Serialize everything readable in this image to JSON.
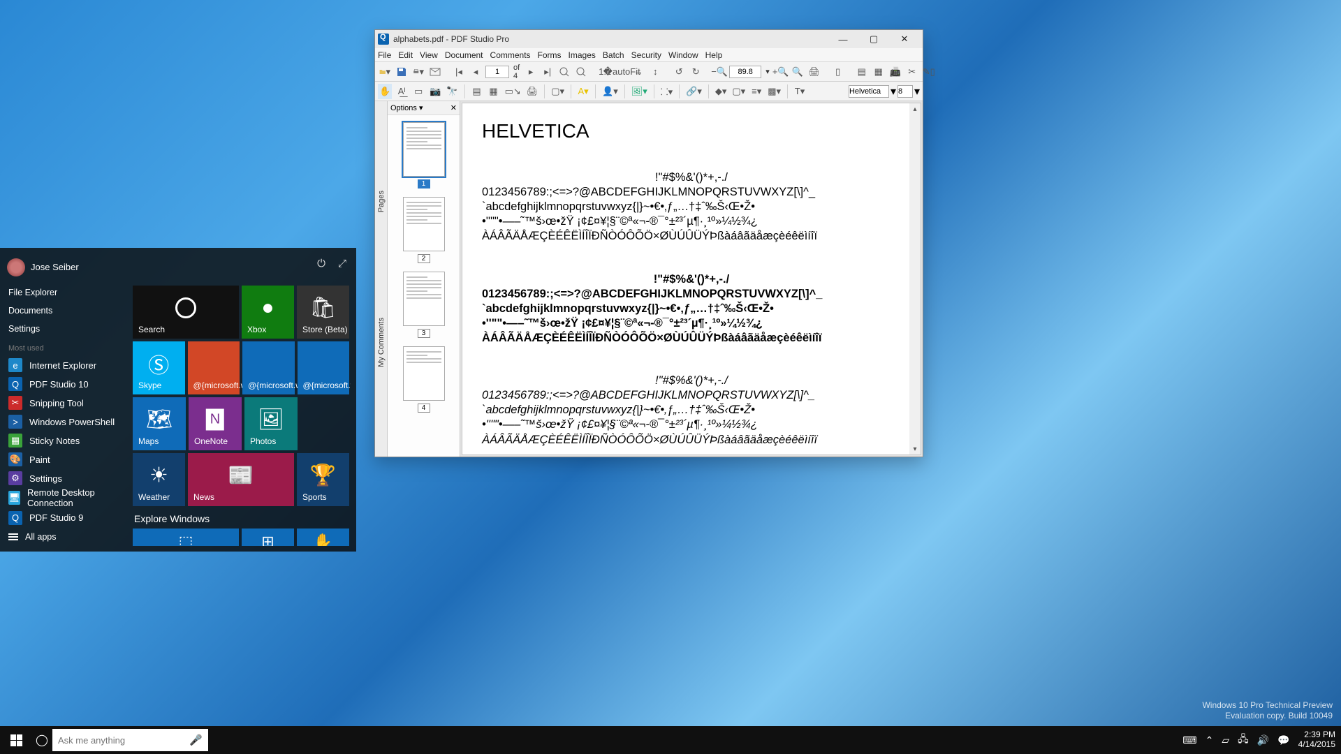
{
  "pdf": {
    "title": "alphabets.pdf - PDF Studio Pro",
    "menus": [
      "File",
      "Edit",
      "View",
      "Document",
      "Comments",
      "Forms",
      "Images",
      "Batch",
      "Security",
      "Window",
      "Help"
    ],
    "page_current": "1",
    "page_total": "of 4",
    "zoom": "89.8",
    "font_name": "Helvetica",
    "font_size": "8",
    "thumb_options": "Options ▾",
    "side_pages": "Pages",
    "side_comments": "My Comments",
    "doc_heading": "HELVETICA",
    "block_head": "!\"#$%&'()*+,-./",
    "block_l1": "0123456789:;<=>?@ABCDEFGHIJKLMNOPQRSTUVWXYZ[\\]^_",
    "block_l2": "`abcdefghijklmnopqrstuvwxyz{|}~•€•‚ƒ„…†‡ˆ‰Š‹Œ•Ž•",
    "block_l3": "•''\"\"•—–˜™š›œ•žŸ ¡¢£¤¥¦§¨©ª«¬-®¯°±²³´µ¶·¸¹º»¼½¾¿",
    "block_l4": "ÀÁÂÃÄÅÆÇÈÉÊËÌÍÎÏÐÑÒÓÔÕÖ×ØÙÚÛÜÝÞßàáâãäåæçèéêëìíîï"
  },
  "start": {
    "user": "Jose Seiber",
    "links": [
      "File Explorer",
      "Documents",
      "Settings"
    ],
    "mostused_hdr": "Most used",
    "items": [
      {
        "label": "Internet Explorer",
        "bg": "#1e88c9",
        "glyph": "e"
      },
      {
        "label": "PDF Studio 10",
        "bg": "#0a63b0",
        "glyph": "Q"
      },
      {
        "label": "Snipping Tool",
        "bg": "#cc2b2b",
        "glyph": "✂"
      },
      {
        "label": "Windows PowerShell",
        "bg": "#1b5fa3",
        "glyph": ">"
      },
      {
        "label": "Sticky Notes",
        "bg": "#3aa23a",
        "glyph": "▦"
      },
      {
        "label": "Paint",
        "bg": "#1b5fa3",
        "glyph": "🎨"
      },
      {
        "label": "Settings",
        "bg": "#5a3da0",
        "glyph": "⚙"
      },
      {
        "label": "Remote Desktop Connection",
        "bg": "#29a6de",
        "glyph": "🖥"
      },
      {
        "label": "PDF Studio 9",
        "bg": "#0a63b0",
        "glyph": "Q"
      }
    ],
    "allapps": "All apps",
    "explore": "Explore Windows",
    "tiles": {
      "search": "Search",
      "xbox": "Xbox",
      "store": "Store (Beta)",
      "skype": "Skype",
      "mswin": "@{microsoft.win",
      "maps": "Maps",
      "onenote": "OneNote",
      "photos": "Photos",
      "weather": "Weather",
      "news": "News",
      "sports": "Sports"
    }
  },
  "taskbar": {
    "search_placeholder": "Ask me anything",
    "time": "2:39 PM",
    "date": "4/14/2015"
  },
  "watermark": {
    "l1": "Windows 10 Pro Technical Preview",
    "l2": "Evaluation copy. Build 10049"
  }
}
